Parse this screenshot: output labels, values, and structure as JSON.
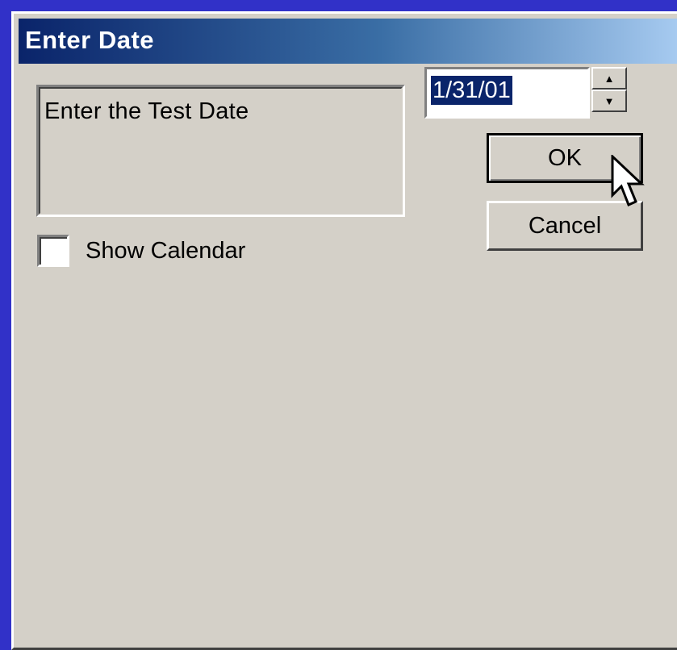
{
  "window": {
    "title": "Enter Date"
  },
  "prompt": {
    "text": "Enter the Test Date"
  },
  "date_field": {
    "value": "1/31/01",
    "selected": true
  },
  "spinner": {
    "up_icon": "arrow-up-icon",
    "down_icon": "arrow-down-icon"
  },
  "buttons": {
    "ok_label": "OK",
    "cancel_label": "Cancel"
  },
  "checkbox": {
    "label": "Show Calendar",
    "checked": false
  },
  "colors": {
    "desktop": "#3131c8",
    "dialog_face": "#d4d0c8",
    "title_start": "#0a246a",
    "title_end": "#a6caf0",
    "selection": "#0a246a"
  },
  "cursor_icon": "mouse-pointer-icon"
}
